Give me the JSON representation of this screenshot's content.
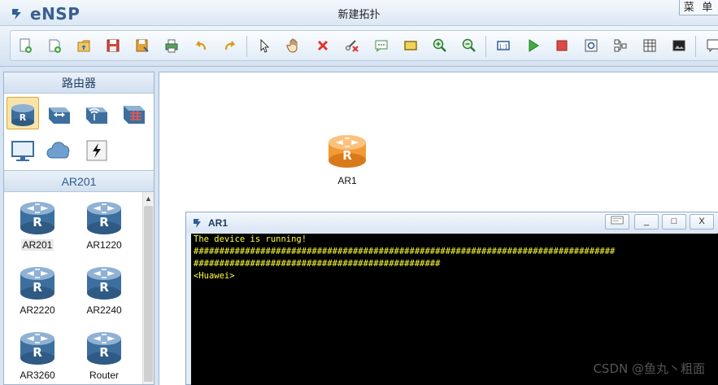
{
  "app": {
    "name": "eNSP",
    "window_title": "新建拓扑",
    "menu_label": "菜 单"
  },
  "toolbar": {
    "buttons": [
      "new-topology",
      "new-example",
      "open",
      "save",
      "save-as",
      "print",
      "undo",
      "redo",
      "select",
      "hand-pan",
      "delete",
      "delete-link",
      "text-annotation",
      "rectangle-annotation",
      "zoom-in",
      "zoom-out",
      "fit-view",
      "start-device",
      "stop-device",
      "capture-data",
      "topology-view",
      "grid-view",
      "screenshot",
      "chat"
    ]
  },
  "left_panel": {
    "section_title": "路由器",
    "categories": [
      {
        "name": "router",
        "selected": true
      },
      {
        "name": "switch",
        "selected": false
      },
      {
        "name": "wireless",
        "selected": false
      },
      {
        "name": "firewall",
        "selected": false
      },
      {
        "name": "pc",
        "selected": false
      },
      {
        "name": "cloud",
        "selected": false
      },
      {
        "name": "link",
        "selected": false
      }
    ],
    "device_section_title": "AR201",
    "devices": [
      {
        "label": "AR201",
        "selected": true
      },
      {
        "label": "AR1220",
        "selected": false
      },
      {
        "label": "AR2220",
        "selected": false
      },
      {
        "label": "AR2240",
        "selected": false
      },
      {
        "label": "AR3260",
        "selected": false
      },
      {
        "label": "Router",
        "selected": false
      }
    ]
  },
  "canvas": {
    "node_label": "AR1"
  },
  "console": {
    "title": "AR1",
    "buttons": {
      "minimize": "_",
      "maximize": "□",
      "close": "X"
    },
    "lines": [
      "The device is running!",
      "##################################################################################",
      "################################################",
      "<Huawei>"
    ]
  },
  "watermark": "CSDN @鱼丸丶粗面",
  "colors": {
    "terminal_text": "#ffff3c",
    "terminal_bg": "#000000",
    "router_orange": "#f39a36",
    "router_blue": "#3d6f9e"
  }
}
